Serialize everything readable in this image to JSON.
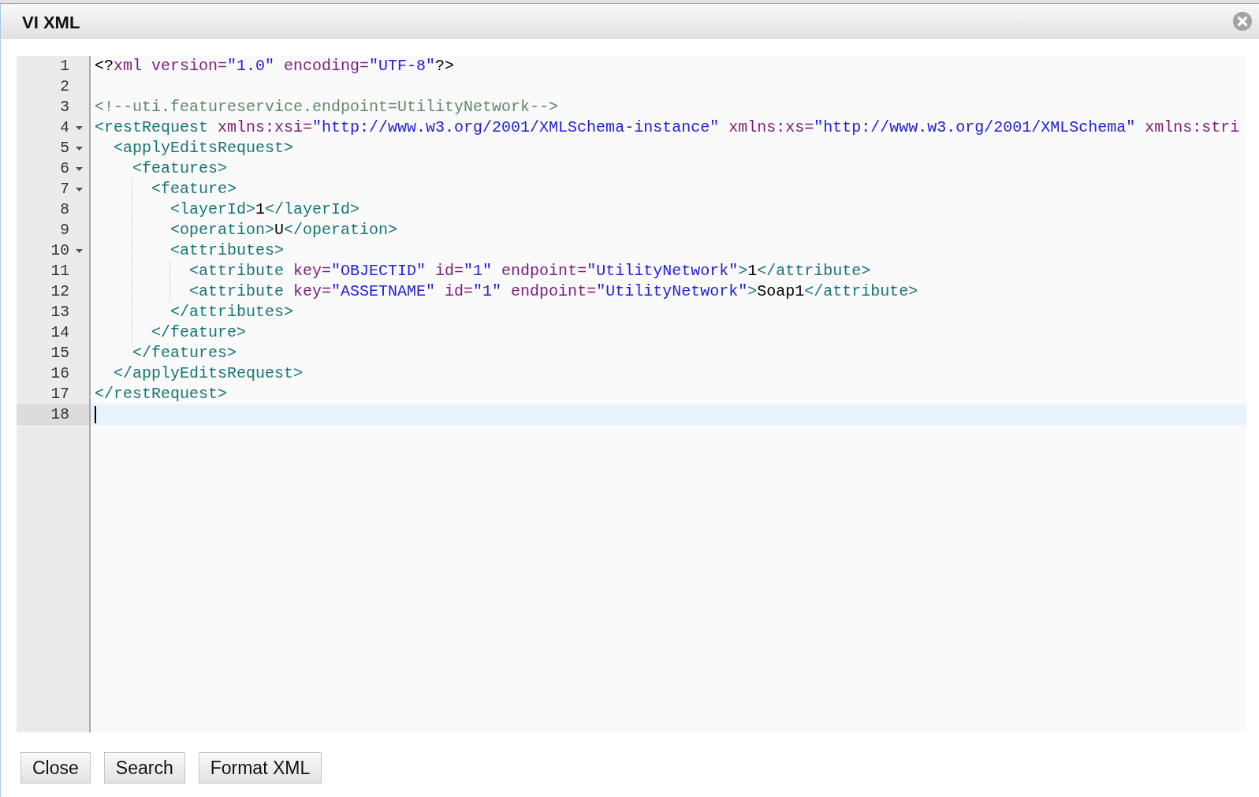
{
  "dialog": {
    "title": "VI XML"
  },
  "editor": {
    "lines": [
      {
        "number": "1",
        "foldable": false,
        "current": false,
        "tokens": [
          {
            "kind": "delimiter",
            "text": "<?"
          },
          {
            "kind": "attribute",
            "text": "xml version="
          },
          {
            "kind": "string",
            "text": "\"1.0\""
          },
          {
            "kind": "attribute",
            "text": " encoding="
          },
          {
            "kind": "string",
            "text": "\"UTF-8\""
          },
          {
            "kind": "delimiter",
            "text": "?>"
          }
        ]
      },
      {
        "number": "2",
        "foldable": false,
        "current": false
      },
      {
        "number": "3",
        "foldable": false,
        "current": false,
        "tokens": [
          {
            "kind": "comment",
            "text": "<!--uti.featureservice.endpoint=UtilityNetwork-->"
          }
        ]
      },
      {
        "number": "4",
        "foldable": true,
        "current": false,
        "tokens": [
          {
            "kind": "tag",
            "text": "<restRequest"
          },
          {
            "kind": "attribute",
            "text": " xmlns:xsi="
          },
          {
            "kind": "string",
            "text": "\"http://www.w3.org/2001/XMLSchema-instance\""
          },
          {
            "kind": "attribute",
            "text": " xmlns:xs="
          },
          {
            "kind": "string",
            "text": "\"http://www.w3.org/2001/XMLSchema\""
          },
          {
            "kind": "attribute",
            "text": " xmlns:stri"
          }
        ]
      },
      {
        "number": "5",
        "foldable": true,
        "current": false,
        "tokens": [
          {
            "kind": "tag",
            "text": "  <applyEditsRequest>"
          }
        ]
      },
      {
        "number": "6",
        "foldable": true,
        "current": false,
        "tokens": [
          {
            "kind": "tag",
            "text": "    <features>"
          }
        ]
      },
      {
        "number": "7",
        "foldable": true,
        "current": false,
        "tokens": [
          {
            "kind": "tag",
            "text": "      <feature>"
          }
        ]
      },
      {
        "number": "8",
        "foldable": false,
        "current": false,
        "tokens": [
          {
            "kind": "tag",
            "text": "        <layerId>"
          },
          {
            "kind": "text",
            "text": "1"
          },
          {
            "kind": "tag",
            "text": "</layerId>"
          }
        ]
      },
      {
        "number": "9",
        "foldable": false,
        "current": false,
        "tokens": [
          {
            "kind": "tag",
            "text": "        <operation>"
          },
          {
            "kind": "text",
            "text": "U"
          },
          {
            "kind": "tag",
            "text": "</operation>"
          }
        ]
      },
      {
        "number": "10",
        "foldable": true,
        "current": false,
        "tokens": [
          {
            "kind": "tag",
            "text": "        <attributes>"
          }
        ]
      },
      {
        "number": "11",
        "foldable": false,
        "current": false,
        "tokens": [
          {
            "kind": "tag",
            "text": "          <attribute"
          },
          {
            "kind": "attribute",
            "text": " key="
          },
          {
            "kind": "string",
            "text": "\"OBJECTID\""
          },
          {
            "kind": "attribute",
            "text": " id="
          },
          {
            "kind": "string",
            "text": "\"1\""
          },
          {
            "kind": "attribute",
            "text": " endpoint="
          },
          {
            "kind": "string",
            "text": "\"UtilityNetwork\""
          },
          {
            "kind": "tag",
            "text": ">"
          },
          {
            "kind": "text",
            "text": "1"
          },
          {
            "kind": "tag",
            "text": "</attribute>"
          }
        ]
      },
      {
        "number": "12",
        "foldable": false,
        "current": false,
        "tokens": [
          {
            "kind": "tag",
            "text": "          <attribute"
          },
          {
            "kind": "attribute",
            "text": " key="
          },
          {
            "kind": "string",
            "text": "\"ASSETNAME\""
          },
          {
            "kind": "attribute",
            "text": " id="
          },
          {
            "kind": "string",
            "text": "\"1\""
          },
          {
            "kind": "attribute",
            "text": " endpoint="
          },
          {
            "kind": "string",
            "text": "\"UtilityNetwork\""
          },
          {
            "kind": "tag",
            "text": ">"
          },
          {
            "kind": "text",
            "text": "Soap1"
          },
          {
            "kind": "tag",
            "text": "</attribute>"
          }
        ]
      },
      {
        "number": "13",
        "foldable": false,
        "current": false,
        "tokens": [
          {
            "kind": "tag",
            "text": "        </attributes>"
          }
        ]
      },
      {
        "number": "14",
        "foldable": false,
        "current": false,
        "tokens": [
          {
            "kind": "tag",
            "text": "      </feature>"
          }
        ]
      },
      {
        "number": "15",
        "foldable": false,
        "current": false,
        "tokens": [
          {
            "kind": "tag",
            "text": "    </features>"
          }
        ]
      },
      {
        "number": "16",
        "foldable": false,
        "current": false,
        "tokens": [
          {
            "kind": "tag",
            "text": "  </applyEditsRequest>"
          }
        ]
      },
      {
        "number": "17",
        "foldable": false,
        "current": false,
        "tokens": [
          {
            "kind": "tag",
            "text": "</restRequest>"
          }
        ]
      },
      {
        "number": "18",
        "foldable": false,
        "current": true
      }
    ]
  },
  "buttons": [
    "Close",
    "Search",
    "Format XML"
  ]
}
